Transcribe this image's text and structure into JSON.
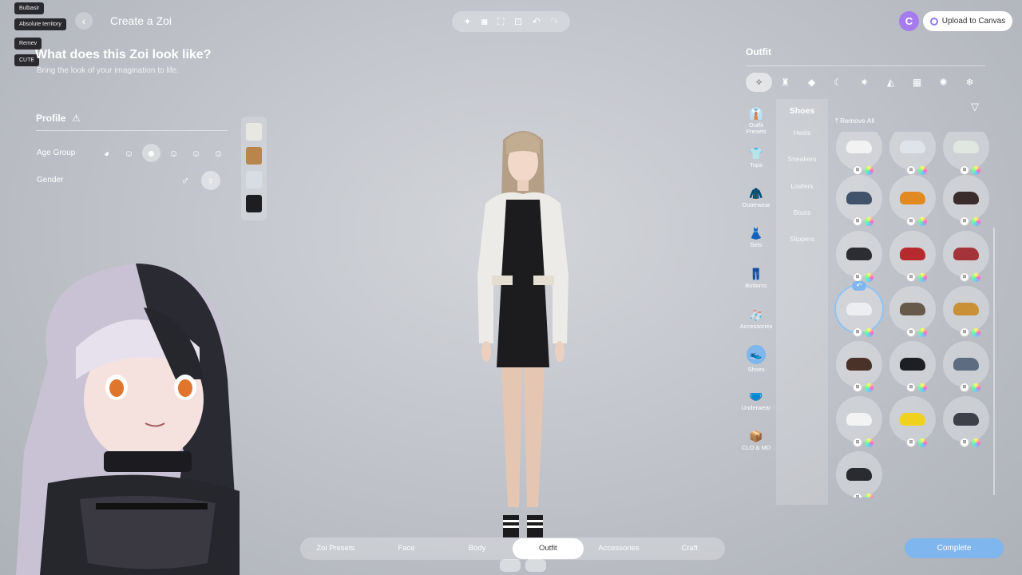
{
  "chat": {
    "tags": [
      "Bulbasir",
      "Absolute territory",
      "Remev",
      "CUTE"
    ]
  },
  "header": {
    "title": "Create a Zoi",
    "headline": "What does this Zoi look like?",
    "subline": "Bring the look of your imagination to life.",
    "toolbar_icons": [
      "sparkle-icon",
      "camera-icon",
      "frame-icon",
      "focus-icon",
      "undo-icon",
      "redo-icon"
    ],
    "canvas_logo": "C",
    "upload_label": "Upload to Canvas"
  },
  "profile": {
    "title": "Profile",
    "warning_icon": "⚠",
    "age_group_label": "Age Group",
    "gender_label": "Gender",
    "male_symbol": "♂",
    "female_symbol": "♀"
  },
  "outfit": {
    "title": "Outfit",
    "remove_all": "Remove All",
    "side_nav": [
      {
        "label": "Outfit Presets",
        "icon": "👔"
      },
      {
        "label": "Tops",
        "icon": "👕"
      },
      {
        "label": "Outerwear",
        "icon": "🧥"
      },
      {
        "label": "Sets",
        "icon": "👗"
      },
      {
        "label": "Bottoms",
        "icon": "👖"
      },
      {
        "label": "Accessories",
        "icon": "🧦"
      },
      {
        "label": "Shoes",
        "icon": "👟"
      },
      {
        "label": "Underwear",
        "icon": "🩲"
      },
      {
        "label": "CLO & MD",
        "icon": "📦"
      }
    ],
    "sub_title": "Shoes",
    "sub_items": [
      "Heels",
      "Sneakers",
      "Loafers",
      "Boots",
      "Slippers"
    ]
  },
  "bottom_nav": {
    "tabs": [
      "Zoi Presets",
      "Face",
      "Body",
      "Outfit",
      "Accessories",
      "Craft"
    ],
    "selected": "Outfit"
  },
  "complete_label": "Complete",
  "colors": {
    "accent": "#7fb6ee",
    "canvas_brand": "#a47cf0"
  }
}
